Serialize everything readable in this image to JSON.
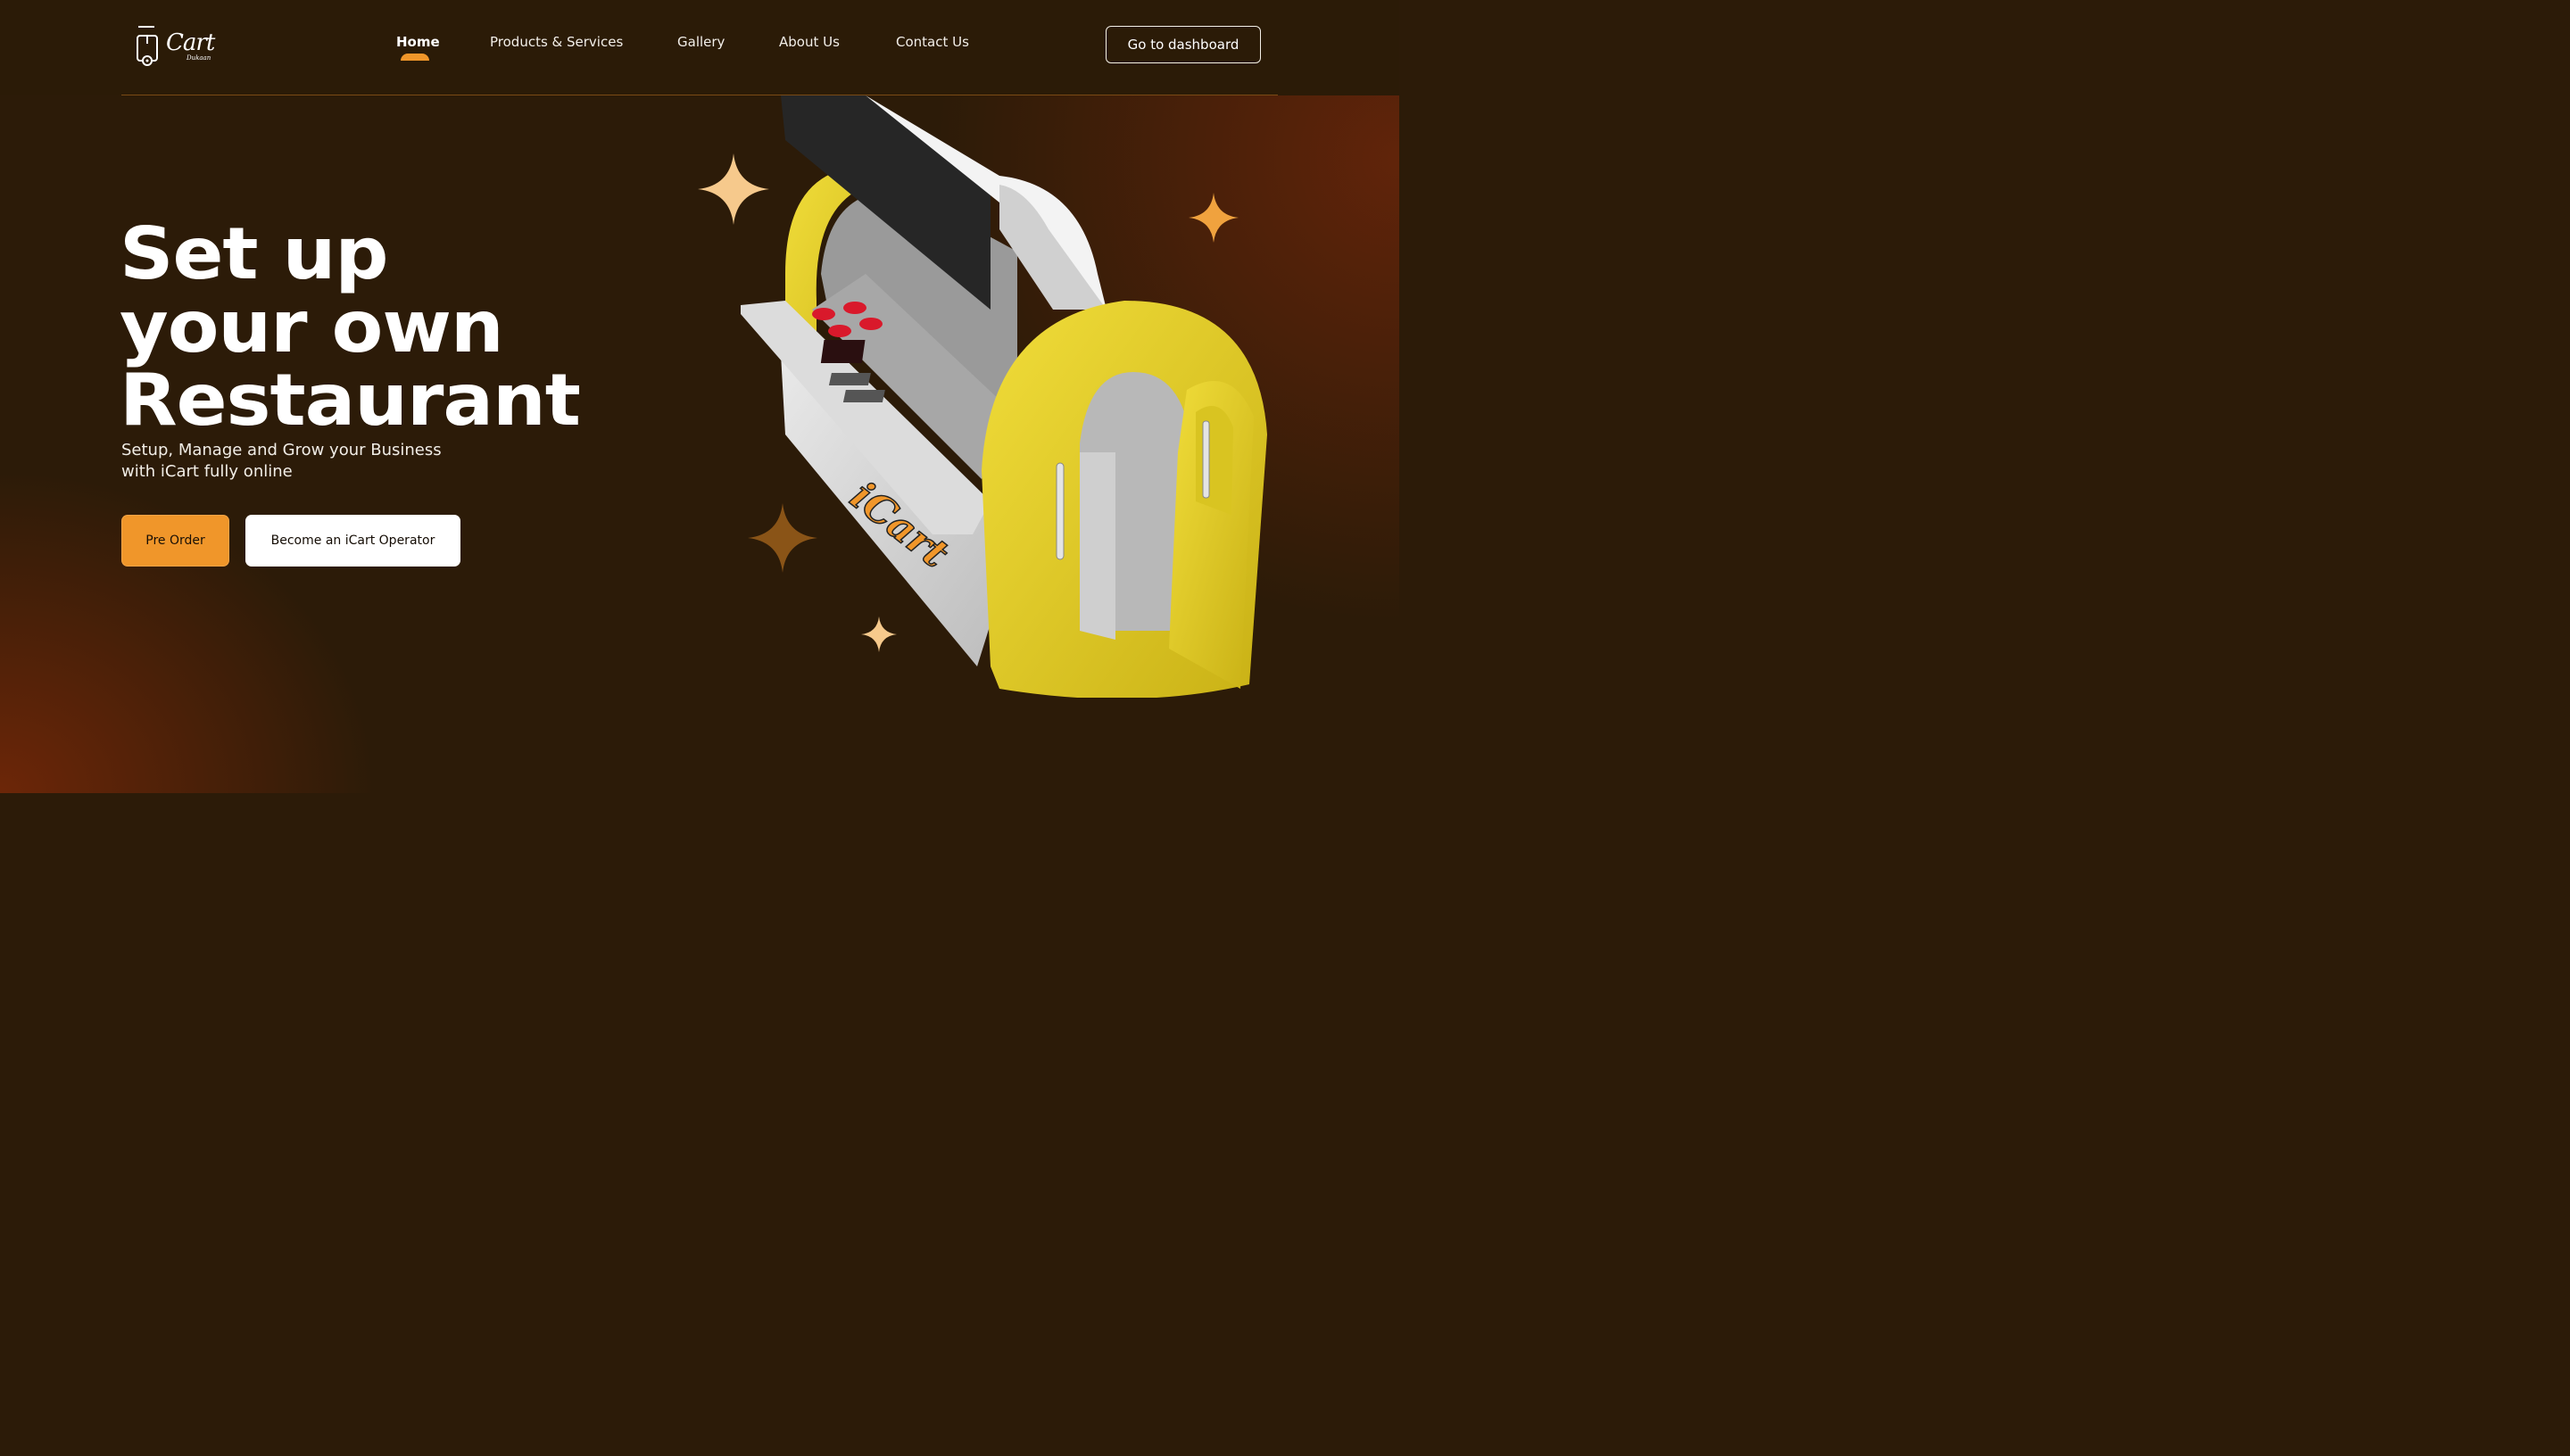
{
  "logo": {
    "text": "Cart",
    "subtext": "Dukaan",
    "icon": "food-cart-icon"
  },
  "nav": {
    "items": [
      {
        "label": "Home",
        "active": true
      },
      {
        "label": "Products & Services",
        "active": false
      },
      {
        "label": "Gallery",
        "active": false
      },
      {
        "label": "About Us",
        "active": false
      },
      {
        "label": "Contact Us",
        "active": false
      }
    ],
    "dashboard_label": "Go to dashboard"
  },
  "hero": {
    "title_lines": [
      "Set up",
      "your own",
      "Restaurant"
    ],
    "subtitle_line1": "Setup, Manage and Grow your Business",
    "subtitle_line2": "with iCart fully online",
    "pre_order_label": "Pre Order",
    "operator_label": "Become an iCart Operator"
  },
  "colors": {
    "background": "#2c1b08",
    "accent": "#f0962a",
    "sparkle_light": "#f6c98c",
    "sparkle_orange": "#f0a23e",
    "sparkle_dark": "#8a5417",
    "cart_yellow": "#e5cf24"
  },
  "illustration": {
    "brand_text": "iCart"
  }
}
